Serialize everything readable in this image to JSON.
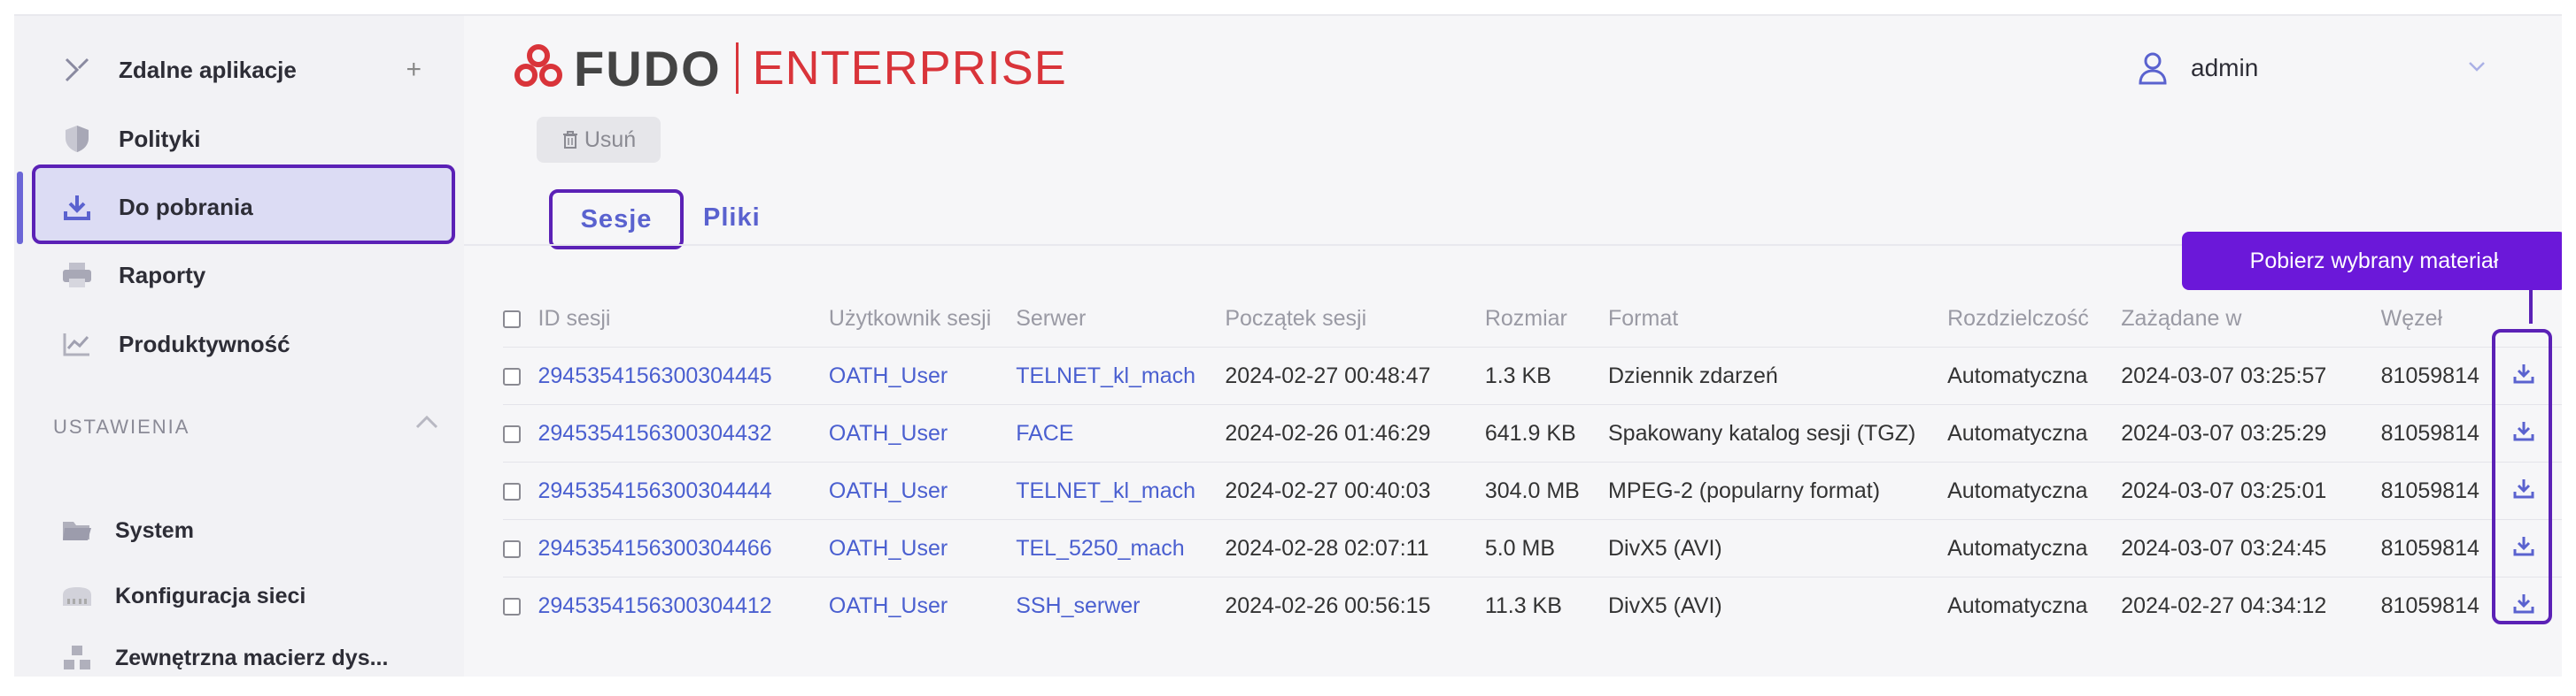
{
  "sidebar": {
    "items": [
      {
        "label": "Zdalne aplikacje",
        "icon": "remote-apps-icon",
        "action": "+"
      },
      {
        "label": "Polityki",
        "icon": "shield-icon"
      },
      {
        "label": "Do pobrania",
        "icon": "download-icon",
        "active": true
      },
      {
        "label": "Raporty",
        "icon": "printer-icon"
      },
      {
        "label": "Produktywność",
        "icon": "chart-icon"
      }
    ],
    "section_title": "USTAWIENIA",
    "settings": [
      {
        "label": "System",
        "icon": "folder-icon"
      },
      {
        "label": "Konfiguracja sieci",
        "icon": "network-icon"
      },
      {
        "label": "Zewnętrzna macierz dys...",
        "icon": "storage-icon"
      }
    ]
  },
  "header": {
    "logo_left": "FUDO",
    "logo_right": "ENTERPRISE",
    "user": "admin"
  },
  "toolbar": {
    "delete_label": "Usuń"
  },
  "tabs": [
    {
      "label": "Sesje",
      "active": true
    },
    {
      "label": "Pliki"
    }
  ],
  "tooltip": "Pobierz wybrany materiał",
  "table": {
    "columns": [
      "ID sesji",
      "Użytkownik sesji",
      "Serwer",
      "Początek sesji",
      "Rozmiar",
      "Format",
      "Rozdzielczość",
      "Zażądane w",
      "Węzeł"
    ],
    "rows": [
      [
        "2945354156300304445",
        "OATH_User",
        "TELNET_kl_mach",
        "2024-02-27 00:48:47",
        "1.3 KB",
        "Dziennik zdarzeń",
        "Automatyczna",
        "2024-03-07 03:25:57",
        "81059814"
      ],
      [
        "2945354156300304432",
        "OATH_User",
        "FACE",
        "2024-02-26 01:46:29",
        "641.9 KB",
        "Spakowany katalog sesji (TGZ)",
        "Automatyczna",
        "2024-03-07 03:25:29",
        "81059814"
      ],
      [
        "2945354156300304444",
        "OATH_User",
        "TELNET_kl_mach",
        "2024-02-27 00:40:03",
        "304.0 MB",
        "MPEG-2 (popularny format)",
        "Automatyczna",
        "2024-03-07 03:25:01",
        "81059814"
      ],
      [
        "2945354156300304466",
        "OATH_User",
        "TEL_5250_mach",
        "2024-02-28 02:07:11",
        "5.0 MB",
        "DivX5 (AVI)",
        "Automatyczna",
        "2024-03-07 03:24:45",
        "81059814"
      ],
      [
        "2945354156300304412",
        "OATH_User",
        "SSH_serwer",
        "2024-02-26 00:56:15",
        "11.3 KB",
        "DivX5 (AVI)",
        "Automatyczna",
        "2024-02-27 04:34:12",
        "81059814"
      ]
    ]
  },
  "colors": {
    "accent": "#5a62cf",
    "highlight": "#5b21b6",
    "tooltip": "#6b18d9",
    "brand": "#d9343a"
  }
}
